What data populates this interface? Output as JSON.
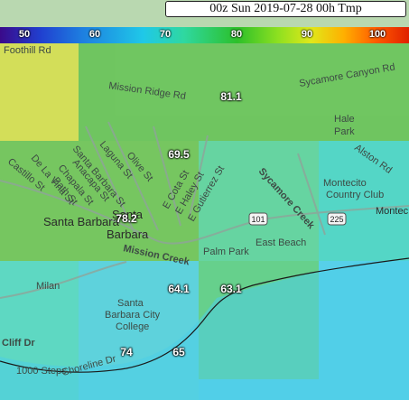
{
  "title": "00z Sun 2019-07-28 00h Tmp",
  "scale": {
    "ticks": [
      "50",
      "60",
      "70",
      "80",
      "90",
      "100"
    ]
  },
  "values": [
    "81.1",
    "69.5",
    "78.2",
    "64.1",
    "63.1",
    "74",
    "65"
  ],
  "places": {
    "santa_barbara": "Santa Barbara",
    "santa": "Santa",
    "barbara": "Barbara",
    "montecito_country_club": "Montecito Country Club",
    "montecito_line1": "Montecito",
    "montecito_line2": "Country Club",
    "montec": "Montec",
    "hale_park_1": "Hale",
    "hale_park_2": "Park",
    "palm_park": "Palm Park",
    "east_beach": "East Beach",
    "sbcc_1": "Santa",
    "sbcc_2": "Barbara City",
    "sbcc_3": "College",
    "mission_creek": "Mission Creek",
    "sycamore_creek": "Sycamore Creek",
    "foothill_rd": "Foothill Rd",
    "mission_ridge_rd": "Mission Ridge Rd",
    "sycamore_canyon_rd": "Sycamore Canyon Rd",
    "alston_rd": "Alston Rd",
    "laguna_st": "Laguna St",
    "olive_st": "Olive St",
    "santa_barbara_st": "Santa Barbara St",
    "anacapa_st": "Anacapa St",
    "chapala_st": "Chapala St",
    "bath_st": "Bath St",
    "de_la_vina_st": "De La Vina St",
    "castillo_st": "Castillo St",
    "cota_st": "E Cota St",
    "haley_st": "E Haley St",
    "gutierrez_st": "E Gutierrez St",
    "shoreline_dr": "Shoreline Dr",
    "cliff_dr": "Cliff Dr",
    "milan": "Milan",
    "steps": "1000 Steps",
    "hwy_101": "101",
    "hwy_225": "225"
  }
}
